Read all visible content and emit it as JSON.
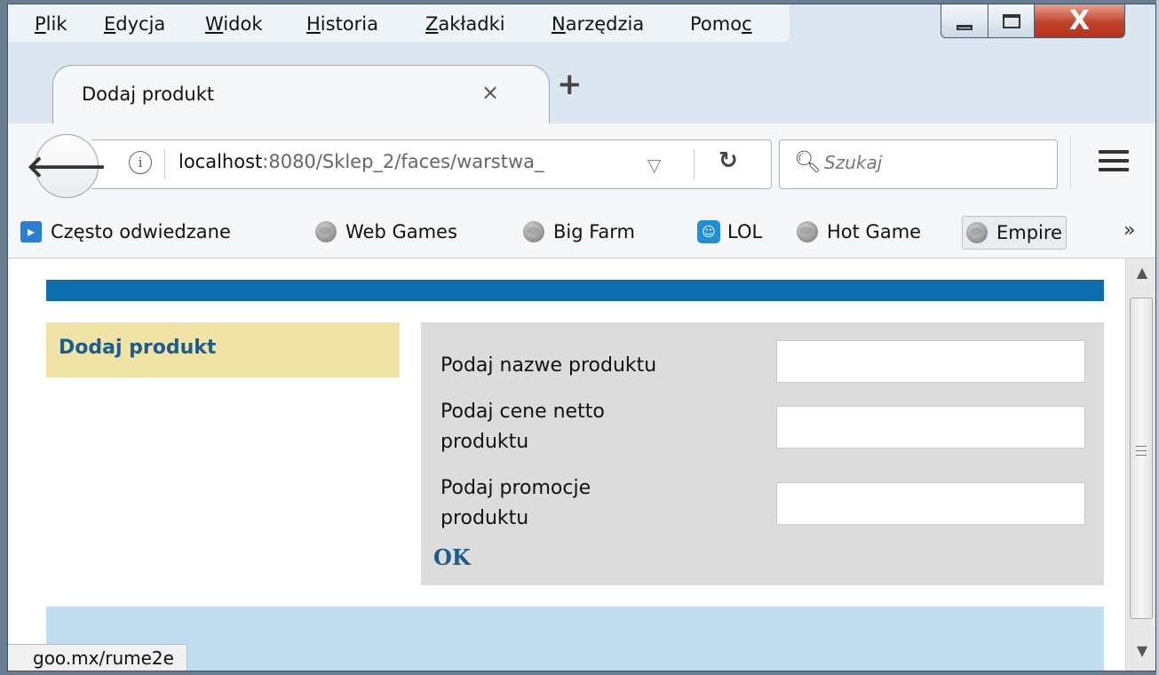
{
  "menu": {
    "items": [
      {
        "key": "P",
        "rest": "lik"
      },
      {
        "key": "E",
        "rest": "dycja"
      },
      {
        "key": "W",
        "rest": "idok"
      },
      {
        "key": "H",
        "rest": "istoria"
      },
      {
        "key": "Z",
        "rest": "akładki"
      },
      {
        "key": "N",
        "rest": "arzędzia"
      },
      {
        "pre": "Pomo",
        "key": "c"
      }
    ]
  },
  "window_controls": {
    "close_glyph": "X"
  },
  "tab": {
    "title": "Dodaj produkt",
    "close_glyph": "×",
    "new_tab_glyph": "+"
  },
  "nav": {
    "url_host": "localhost",
    "url_rest": ":8080/Sklep_2/faces/warstwa_",
    "info_glyph": "i",
    "search_placeholder": "Szukaj"
  },
  "bookmarks": {
    "items": [
      "Często odwiedzane",
      "Web Games",
      "Big Farm",
      "LOL",
      "Hot Game",
      "Empire"
    ],
    "overflow_glyph": "»"
  },
  "page": {
    "sidebar_title": "Dodaj produkt",
    "form": {
      "name_label": "Podaj nazwe produktu",
      "price_label_line1": "Podaj cene netto",
      "price_label_line2": "produktu",
      "promo_label_line1": "Podaj promocje",
      "promo_label_line2": "produktu",
      "submit_label": "OK"
    }
  },
  "status": {
    "link": "goo.mx/rume2e"
  },
  "colors": {
    "header_bar": "#0d6eac",
    "sidebar_bg": "#efe3a6",
    "link_blue": "#1c5c8f",
    "footer_bg": "#c2dcef",
    "form_bg": "#dcdcdc"
  }
}
